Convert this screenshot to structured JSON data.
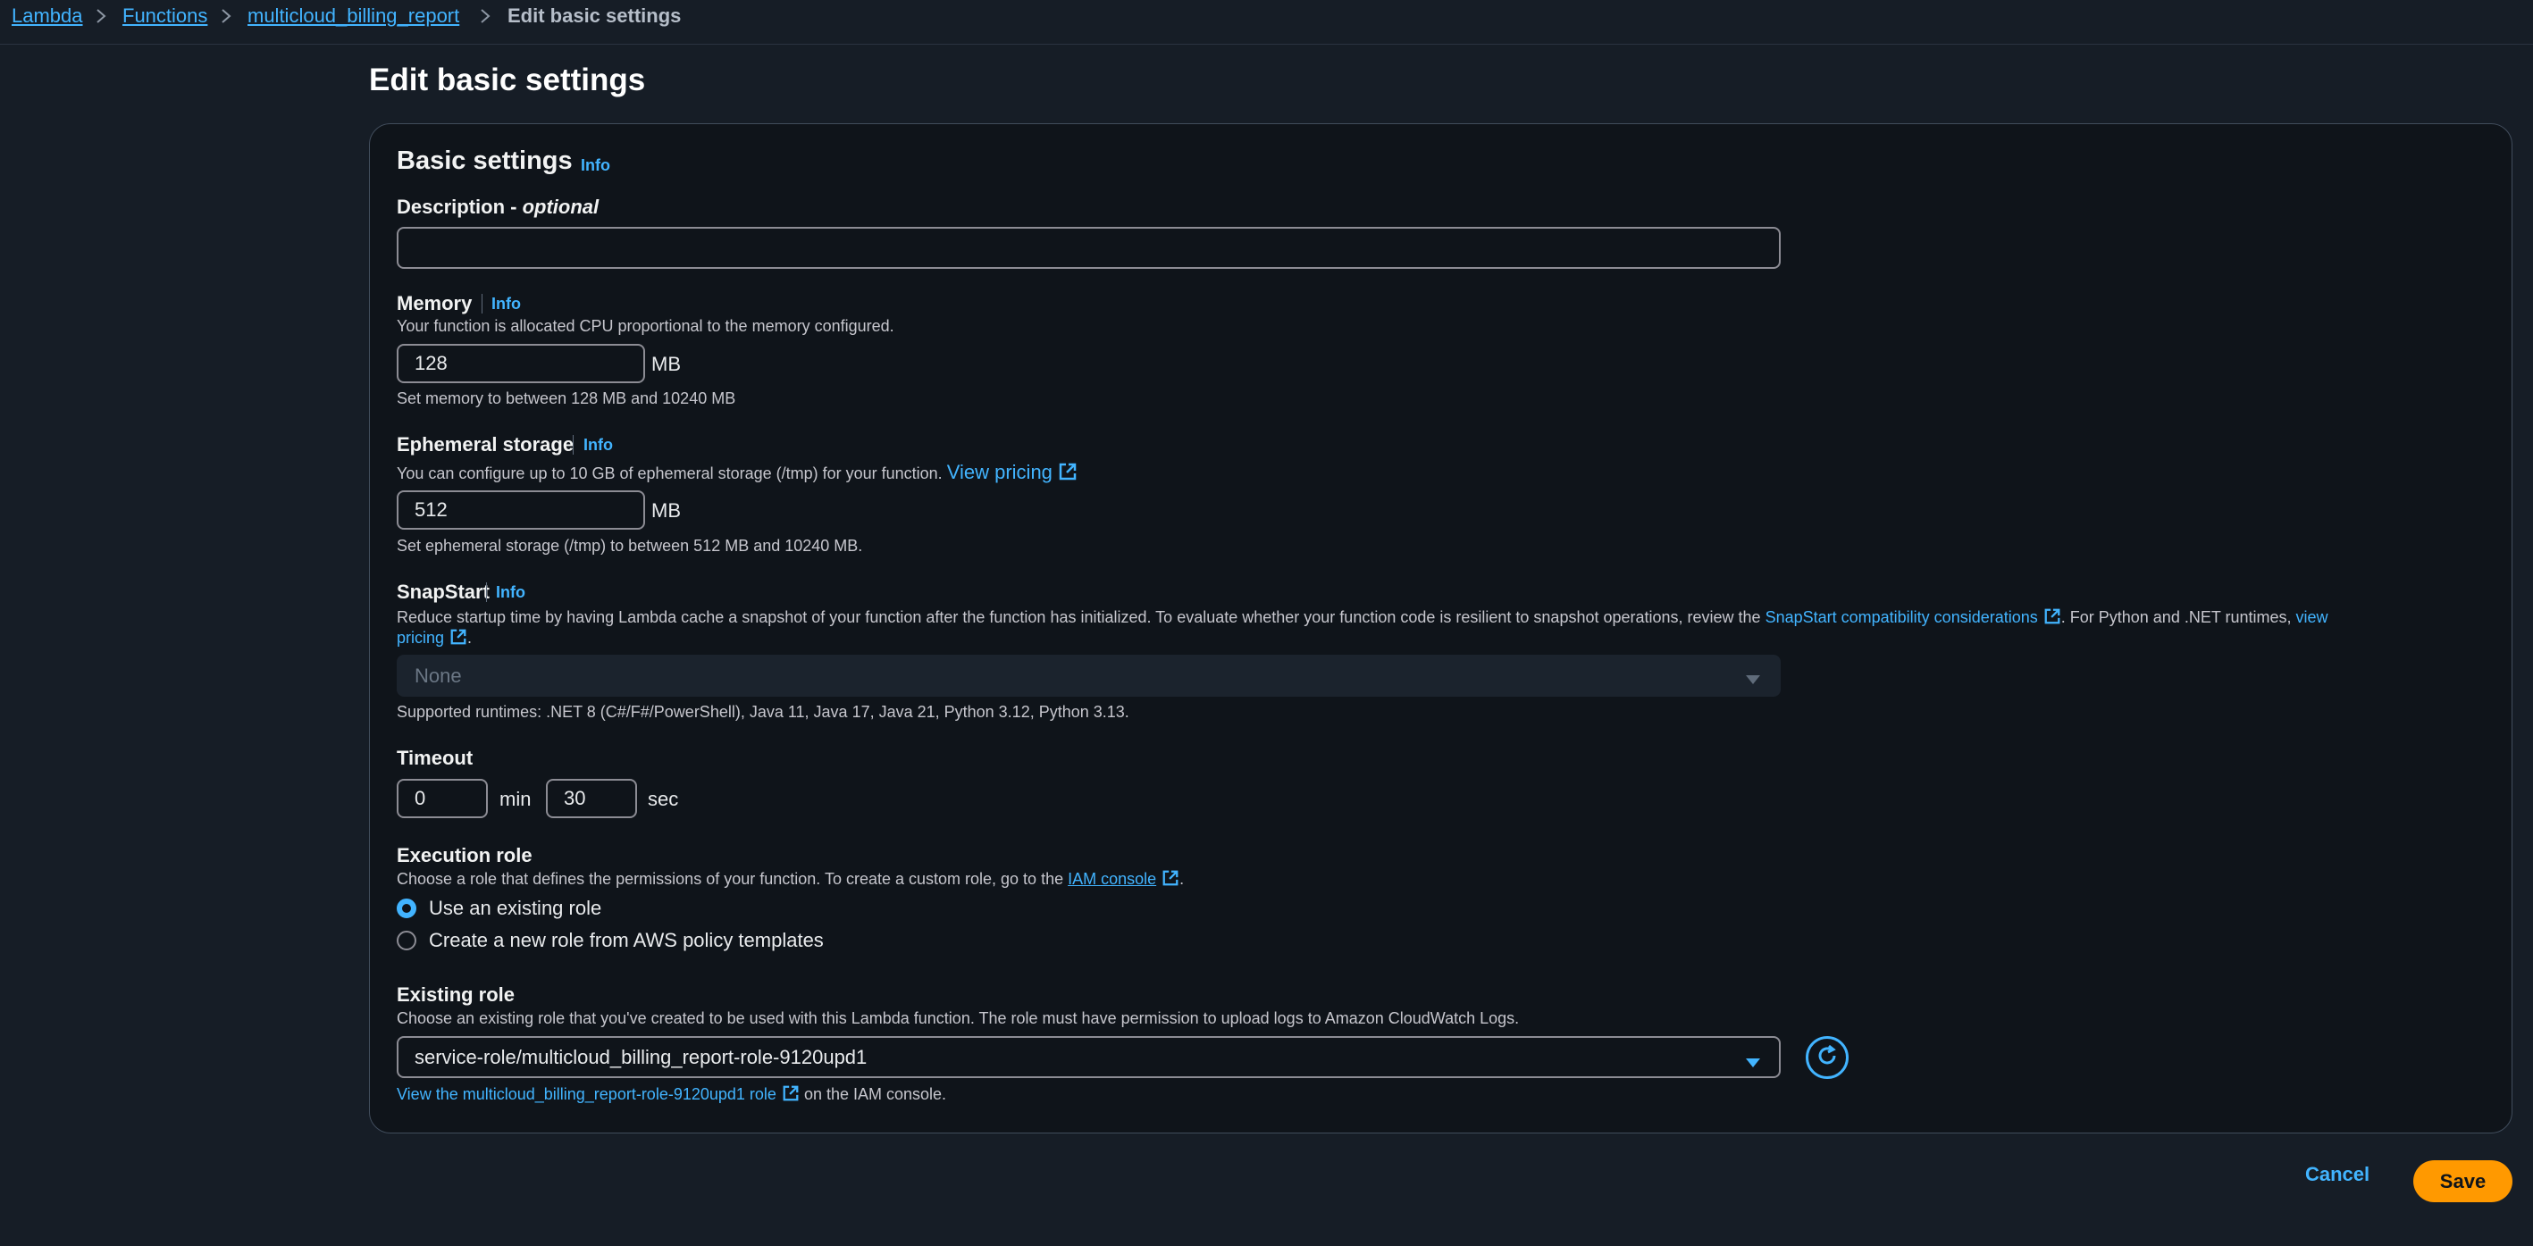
{
  "breadcrumb": {
    "items": [
      "Lambda",
      "Functions",
      "multicloud_billing_report"
    ],
    "current": "Edit basic settings"
  },
  "page_title": "Edit basic settings",
  "basic_settings": {
    "title": "Basic settings",
    "info": "Info",
    "description": {
      "label": "Description - ",
      "label_optional": "optional",
      "value": ""
    },
    "memory": {
      "label": "Memory",
      "info": "Info",
      "help": "Your function is allocated CPU proportional to the memory configured.",
      "value": "128",
      "unit": "MB",
      "constraint": "Set memory to between 128 MB and 10240 MB"
    },
    "ephemeral_storage": {
      "label": "Ephemeral storage",
      "info": "Info",
      "help": "You can configure up to 10 GB of ephemeral storage (/tmp) for your function.",
      "help_link": "View pricing",
      "value": "512",
      "unit": "MB",
      "constraint": "Set ephemeral storage (/tmp) to between 512 MB and 10240 MB."
    },
    "snapstart": {
      "label": "SnapStart",
      "info": "Info",
      "help_part1": "Reduce startup time by having Lambda cache a snapshot of your function after the function has initialized. To evaluate whether your function code is resilient to snapshot operations, review the",
      "help_link1": "SnapStart compatibility considerations",
      "help_part2": ". For Python and .NET runtimes,",
      "help_link2a": "view",
      "help_link2b": "pricing",
      "help_end": ".",
      "selected": "None",
      "supported": "Supported runtimes: .NET 8 (C#/F#/PowerShell), Java 11, Java 17, Java 21, Python 3.12, Python 3.13."
    },
    "timeout": {
      "label": "Timeout",
      "min_value": "0",
      "min_unit": "min",
      "sec_value": "30",
      "sec_unit": "sec"
    },
    "execution_role": {
      "label": "Execution role",
      "help": "Choose a role that defines the permissions of your function. To create a custom role, go to the",
      "help_link": "IAM console",
      "help_end": ".",
      "options": [
        "Use an existing role",
        "Create a new role from AWS policy templates"
      ],
      "selected_index": 0
    },
    "existing_role": {
      "label": "Existing role",
      "help": "Choose an existing role that you've created to be used with this Lambda function. The role must have permission to upload logs to Amazon CloudWatch Logs.",
      "selected": "service-role/multicloud_billing_report-role-9120upd1",
      "view_link": "View the multicloud_billing_report-role-9120upd1 role",
      "view_suffix": "on the IAM console."
    }
  },
  "actions": {
    "cancel": "Cancel",
    "save": "Save"
  },
  "colors": {
    "background": "#161d26",
    "panel": "#0f141a",
    "link": "#42b4ff",
    "primary_button": "#ff9900"
  }
}
